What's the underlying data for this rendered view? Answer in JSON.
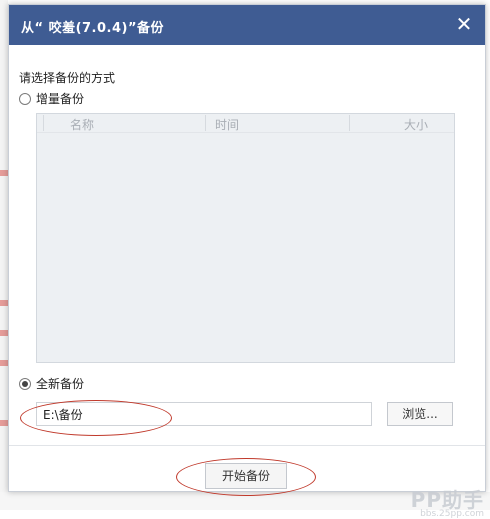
{
  "dialog": {
    "title": "从“ 咬羞(7.0.4)”备份",
    "close_glyph": "✕",
    "section_label": "请选择备份的方式",
    "option_incremental": {
      "label": "增量备份",
      "checked": false
    },
    "table": {
      "columns": [
        "名称",
        "时间",
        "大小"
      ]
    },
    "option_full": {
      "label": "全新备份",
      "checked": true
    },
    "path_value": "E:\\备份",
    "browse_label": "浏览...",
    "start_label": "开始备份"
  },
  "annotation_color": "#c0392b",
  "watermark": {
    "text": "PP助手",
    "sub": "bbs.25pp.com"
  }
}
